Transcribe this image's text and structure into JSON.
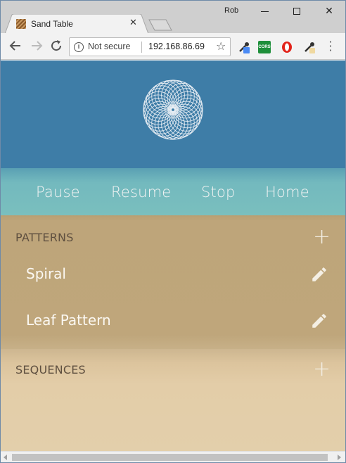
{
  "browser": {
    "profile_name": "Rob",
    "tab_title": "Sand Table",
    "security_label": "Not secure",
    "url": "192.168.86.69",
    "extensions": [
      "eyedropper-icon",
      "cors-icon",
      "opera-icon",
      "eyedropper-icon"
    ],
    "cors_label": "CORS"
  },
  "controls": {
    "pause": "Pause",
    "resume": "Resume",
    "stop": "Stop",
    "home": "Home"
  },
  "patterns": {
    "heading": "PATTERNS",
    "items": [
      {
        "label": "Spiral"
      },
      {
        "label": "Leaf Pattern"
      }
    ]
  },
  "sequences": {
    "heading": "SEQUENCES",
    "items": []
  },
  "colors": {
    "header": "#3e7da7",
    "controls": "#73b9be",
    "patterns_bg": "#bfa67b",
    "sequences_bg": "#e3cda8"
  }
}
